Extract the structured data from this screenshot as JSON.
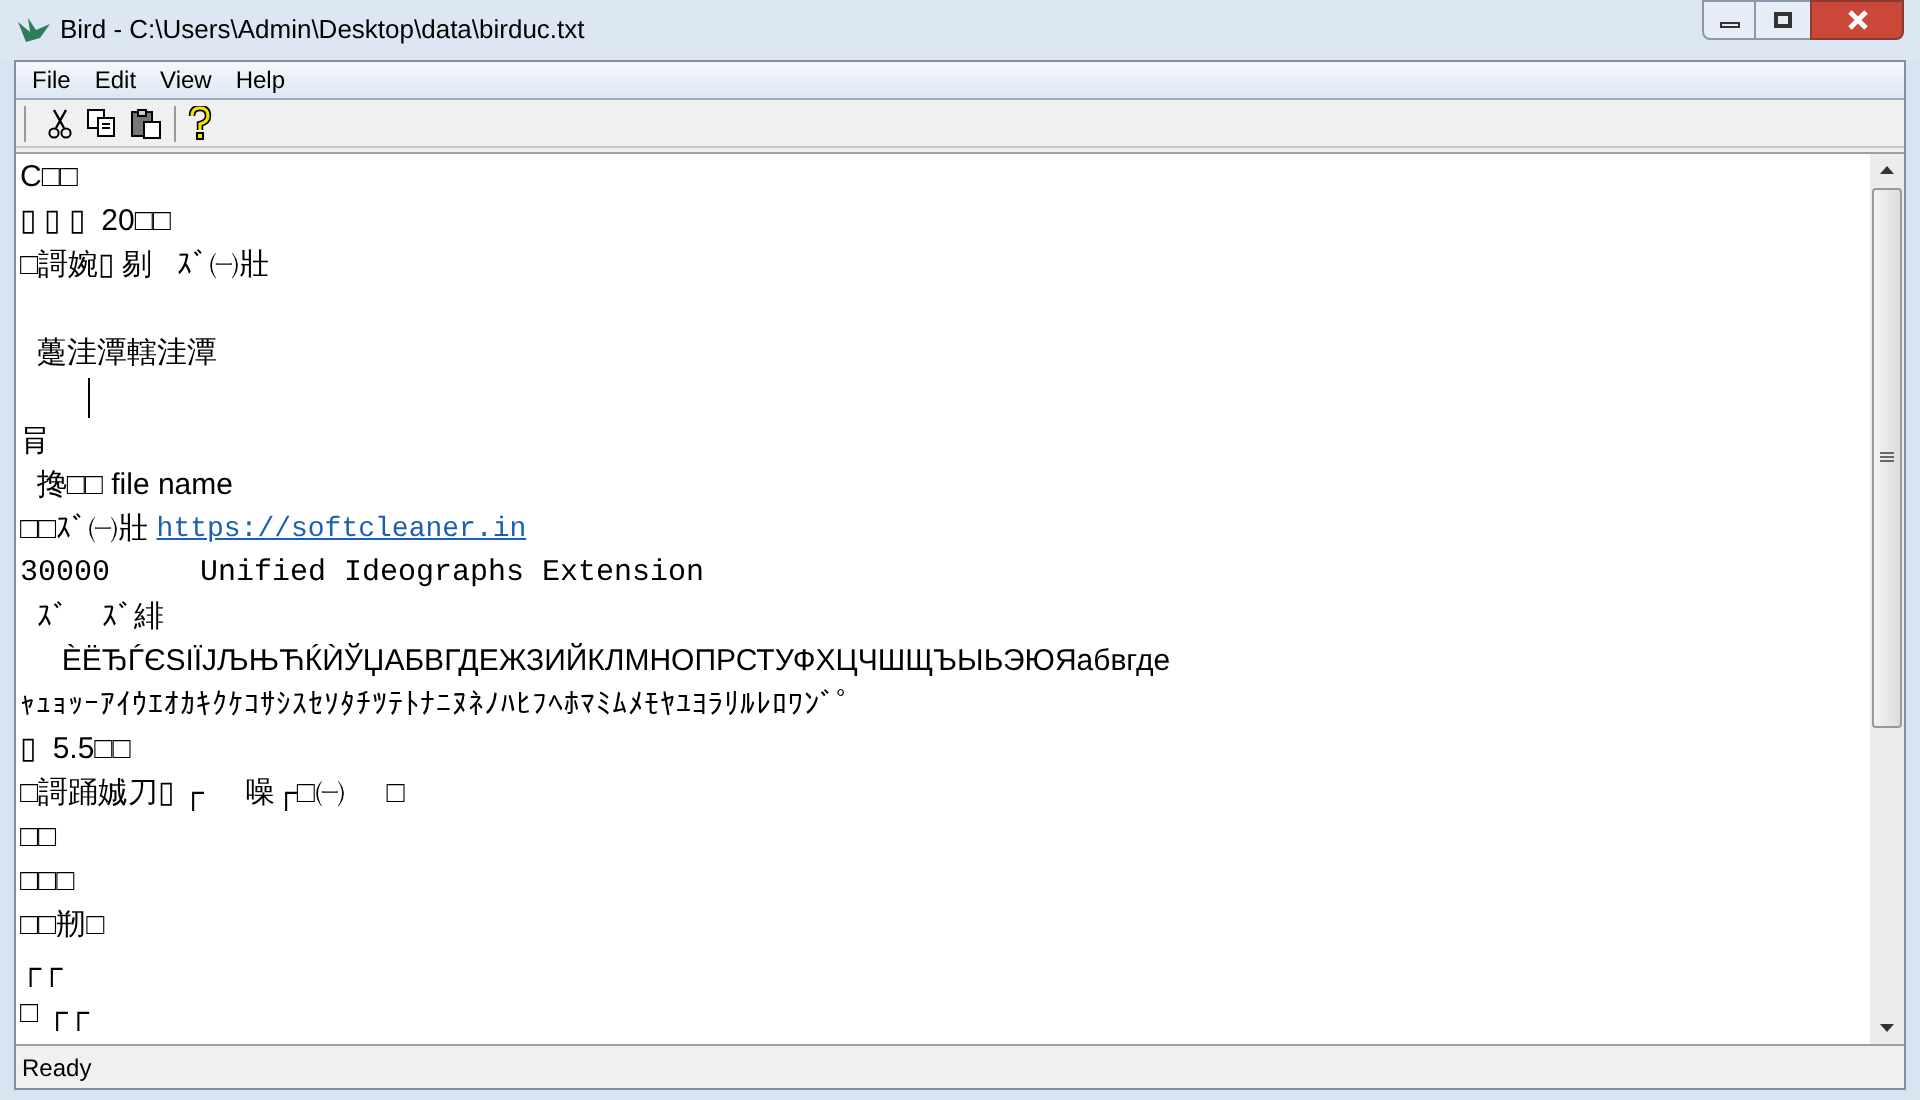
{
  "window": {
    "title": "Bird - C:\\Users\\Admin\\Desktop\\data\\birduc.txt"
  },
  "menu": [
    "File",
    "Edit",
    "View",
    "Help"
  ],
  "lines": [
    {
      "kind": "text",
      "text": "C□□"
    },
    {
      "kind": "text",
      "text": "▯ ▯ ▯  20□□"
    },
    {
      "kind": "text",
      "text": "□謌婉▯ 剔   ｽﾞ㈠壯"
    },
    {
      "kind": "blank"
    },
    {
      "kind": "text",
      "text": "  躉洼潭轄洼潭"
    },
    {
      "kind": "caret"
    },
    {
      "kind": "text",
      "text": "肙"
    },
    {
      "kind": "text",
      "text": "  搀□□ file name"
    },
    {
      "kind": "link",
      "text": "□□ｽﾞ㈠壯 ",
      "link": "https://softcleaner.in"
    },
    {
      "kind": "mono",
      "text": "30000     Unified Ideographs Extension"
    },
    {
      "kind": "text",
      "text": "  ｽﾞ    ｽﾞ緋"
    },
    {
      "kind": "text",
      "text": "     ÈËЂЃЄЅІЇЈЉЊЋЌЍЎЏАБВГДЕЖЗИЙКЛМНОПРСТУФХЦЧШЩЪЫЬЭЮЯабвгде"
    },
    {
      "kind": "small",
      "text": "ｬｭｮｯｰｱｲｳｴｵｶｷｸｹｺｻｼｽｾｿﾀﾁﾂﾃﾄﾅﾆﾇﾈﾉﾊﾋﾌﾍﾎﾏﾐﾑﾒﾓﾔﾕﾖﾗﾘﾙﾚﾛﾜﾝﾞﾟ"
    },
    {
      "kind": "text",
      "text": "▯  5.5□□"
    },
    {
      "kind": "text",
      "text": "□謌踊娍刀▯ ┌     噪┌□㈠     □"
    },
    {
      "kind": "text",
      "text": "□□"
    },
    {
      "kind": "text",
      "text": "□□□"
    },
    {
      "kind": "text",
      "text": "□□剏□"
    },
    {
      "kind": "text",
      "text": "┌┌"
    },
    {
      "kind": "text",
      "text": "□ ┌┌"
    }
  ],
  "status_bar": "Ready"
}
